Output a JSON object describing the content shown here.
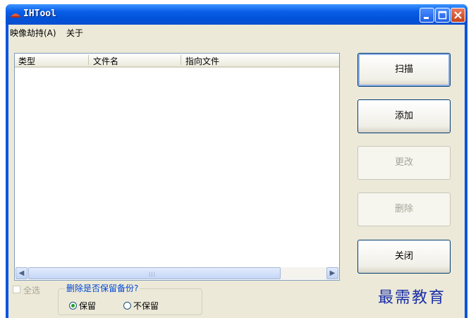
{
  "window": {
    "title": "IHTool"
  },
  "menu": {
    "items": [
      "映像劫持(A)",
      "关于"
    ]
  },
  "list": {
    "columns": [
      "类型",
      "文件名",
      "指向文件"
    ],
    "rows": []
  },
  "buttons": {
    "scan": "扫描",
    "add": "添加",
    "modify": "更改",
    "delete": "删除",
    "close": "关闭"
  },
  "select_all": {
    "label": "全选",
    "checked": false,
    "enabled": false
  },
  "backup_group": {
    "title": "删除是否保留备份?",
    "options": [
      "保留",
      "不保留"
    ],
    "selected": "保留"
  },
  "watermark": "最需教育",
  "colors": {
    "title_bar": "#0a55e0",
    "group_title": "#0046d5",
    "radio_selected": "#21a121",
    "watermark": "#1a2fa6"
  }
}
